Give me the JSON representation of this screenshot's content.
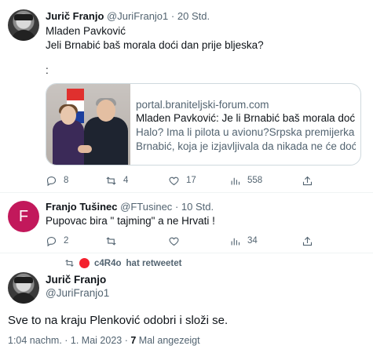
{
  "tweet1": {
    "name": "Jurič Franjo",
    "handle": "@JuriFranjo1",
    "time": "20 Std.",
    "lines": [
      "Mladen Pavković",
      "Jeli Brnabić baš morala doći dan prije bljeska?",
      ":"
    ],
    "card": {
      "domain": "portal.braniteljski-forum.com",
      "title": "Mladen Pavković: Je li Brnabić baš morala doći u ...",
      "desc_line1": "Halo? Ima li pilota u avionu?Srpska premijerka Ana",
      "desc_line2": "Brnabić, koja je izjavljivala da nikada ne će doći u ..."
    },
    "stats": {
      "replies": "8",
      "retweets": "4",
      "likes": "17",
      "views": "558"
    }
  },
  "tweet2": {
    "avatar_letter": "F",
    "avatar_color": "#c2185b",
    "name": "Franjo Tušinec",
    "handle": "@FTusinec",
    "time": "10 Std.",
    "text": "Pupovac bira \" tajming\" a ne Hrvati !",
    "stats": {
      "replies": "2",
      "retweets": "",
      "likes": "",
      "views": "34"
    }
  },
  "retweet_bar": {
    "user": "c4R4o",
    "suffix": "hat retweetet"
  },
  "main_tweet": {
    "name": "Jurič Franjo",
    "handle": "@JuriFranjo1",
    "text": "Sve to na kraju Plenković odobri i složi se.",
    "timestamp": "1:04 nachm. · 1. Mai 2023 ·",
    "view_count": "7",
    "view_label": "Mal angezeigt"
  },
  "separator_dot": "·",
  "colors": {
    "text": "#0f1419",
    "secondary": "#536471",
    "border": "#cfd9de"
  }
}
